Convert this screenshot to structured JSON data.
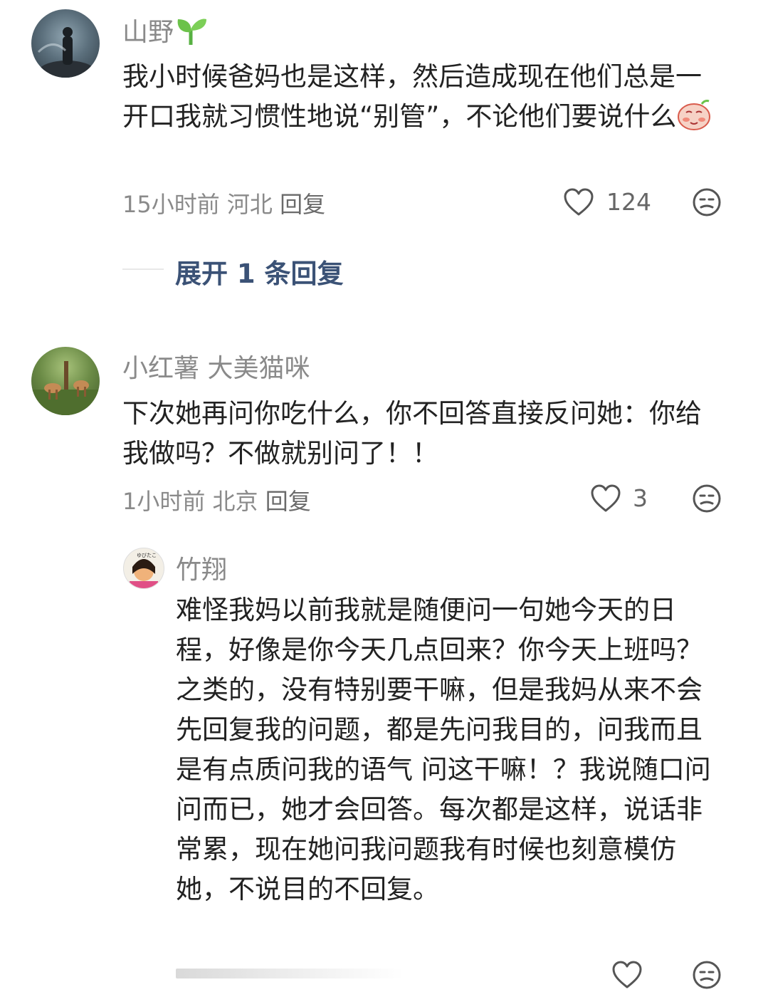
{
  "comments": [
    {
      "username": "山野",
      "username_emoji": "sprout-icon",
      "content": "我小时候爸妈也是这样，然后造成现在他们总是一开口我就习惯性地说“别管”，不论他们要说什么",
      "content_emoji": "blushing-face-emoji",
      "time": "15小时前",
      "location": "河北",
      "reply_label": "回复",
      "likes": "124",
      "expand_label": "展开 1 条回复"
    },
    {
      "username": "小红薯 大美猫咪",
      "content": "下次她再问你吃什么，你不回答直接反问她：你给我做吗？不做就别问了！！",
      "time": "1小时前",
      "location": "北京",
      "reply_label": "回复",
      "likes": "3",
      "replies": [
        {
          "username": "竹翔",
          "content": "难怪我妈以前我就是随便问一句她今天的日程，好像是你今天几点回来？你今天上班吗？之类的，没有特别要干嘛，但是我妈从来不会先回复我的问题，都是先问我目的，问我而且是有点质问我的语气 问这干嘛！？我说随口问问而已，她才会回答。每次都是这样，说话非常累，现在她问我问题我有时候也刻意模仿她，不说目的不回复。"
        }
      ]
    }
  ],
  "icons": {
    "like": "heart-outline-icon",
    "dislike": "unamused-face-icon"
  },
  "colors": {
    "text": "#222222",
    "meta": "#8a8a8a",
    "expand": "#3b5276",
    "background": "#ffffff"
  }
}
